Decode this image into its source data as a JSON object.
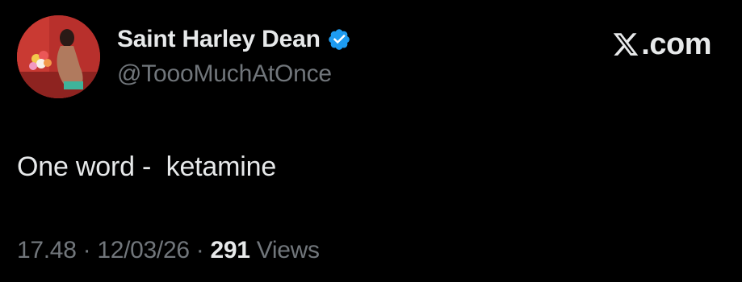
{
  "author": {
    "display_name": "Saint Harley Dean",
    "handle": "@ToooMuchAtOnce",
    "verified": true,
    "verified_color": "#1d9bf0"
  },
  "brand": {
    "text": ".com",
    "icon": "x-logo-icon"
  },
  "post": {
    "text": "One word -  ketamine"
  },
  "meta": {
    "time": "17.48",
    "separator": " · ",
    "date": "12/03/26",
    "views_count": "291",
    "views_label": "Views"
  },
  "colors": {
    "background": "#000000",
    "primary_text": "#e7e9ea",
    "secondary_text": "#71767b"
  }
}
